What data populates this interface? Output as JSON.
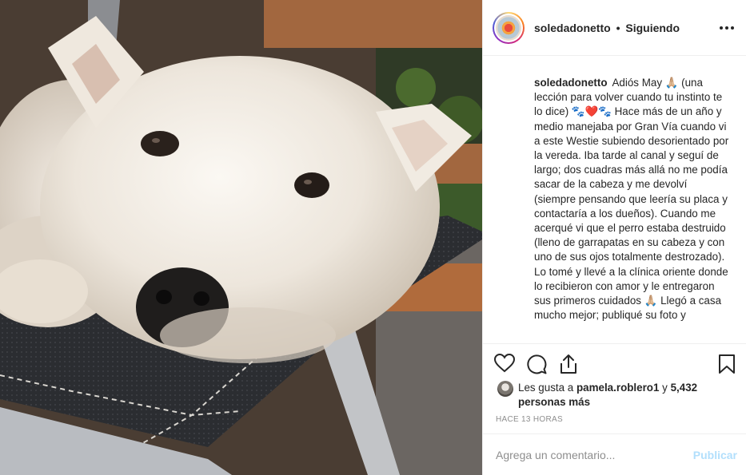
{
  "post": {
    "image_alt": "Perro Westie blanco recostado sobre una silla de tela negra",
    "author": {
      "username": "soledadonetto",
      "separator": "•",
      "follow_status": "Siguiendo"
    },
    "caption": {
      "username": "soledadonetto",
      "text": "Adiós May 🙏🏼 (una lección para volver cuando tu instinto te lo dice) 🐾❤️🐾 Hace más de un año y medio manejaba por Gran Vía cuando vi a este Westie subiendo desorientado por la vereda. Iba tarde al canal y seguí de largo; dos cuadras más allá no me podía sacar de la cabeza y me devolví (siempre pensando que leería su placa y contactaría a los dueños). Cuando me acerqué vi que el perro estaba destruido (lleno de garrapatas en su cabeza y con uno de sus ojos totalmente destrozado). Lo tomé y llevé a la clínica oriente donde lo recibieron con amor y le entregaron sus primeros cuidados 🙏🏼 Llegó a casa mucho mejor; publiqué su foto y"
    },
    "likes": {
      "prefix": "Les gusta a",
      "first_user": "pamela.roblero1",
      "connector": "y",
      "others": "5,432 personas más"
    },
    "timestamp": "HACE 13 HORAS",
    "comment": {
      "placeholder": "Agrega un comentario...",
      "publish_label": "Publicar"
    },
    "icons": {
      "more": "more-options-icon",
      "like": "heart-icon",
      "comment": "comment-bubble-icon",
      "share": "share-icon",
      "save": "bookmark-icon"
    },
    "colors": {
      "text": "#262626",
      "secondary": "#8e8e8e",
      "publish_disabled": "#b2dffc",
      "border": "#efefef"
    }
  }
}
